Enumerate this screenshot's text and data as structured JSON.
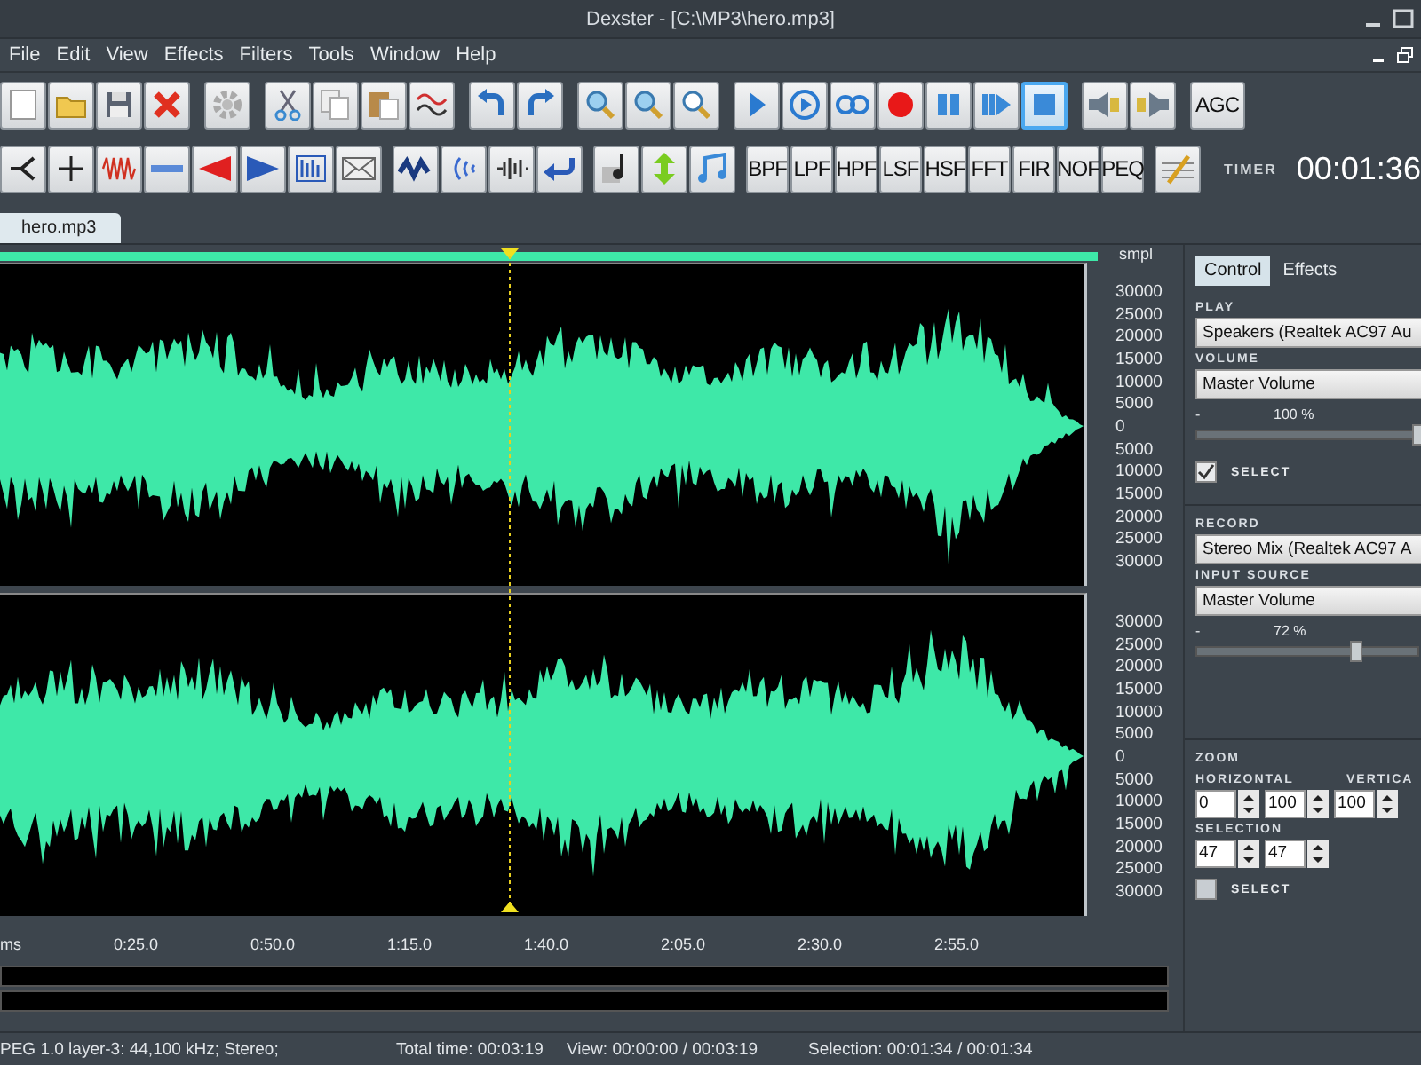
{
  "window": {
    "title": "Dexster - [C:\\MP3\\hero.mp3]"
  },
  "menu": [
    "File",
    "Edit",
    "View",
    "Effects",
    "Filters",
    "Tools",
    "Window",
    "Help"
  ],
  "toolbar_1": {
    "transport": [
      {
        "selected": false
      },
      {
        "selected": false
      },
      {
        "selected": false
      },
      {
        "selected": false
      },
      {
        "selected": false
      },
      {
        "selected": false
      },
      {
        "selected": true
      }
    ],
    "agc": "AGC"
  },
  "toolbar_2": {
    "filters": [
      "BPF",
      "LPF",
      "HPF",
      "LSF",
      "HSF",
      "FFT",
      "FIR",
      "NOF",
      "PEQ"
    ],
    "timer_label": "TIMER",
    "timer": "00:01:36"
  },
  "document_tabs": [
    {
      "label": "hero.mp3",
      "selected": true
    }
  ],
  "waveform": {
    "unit": "smpl",
    "channels": [
      {
        "ticks": [
          "30000",
          "25000",
          "20000",
          "15000",
          "10000",
          "5000",
          "0",
          "5000",
          "10000",
          "15000",
          "20000",
          "25000",
          "30000"
        ]
      },
      {
        "ticks": [
          "30000",
          "25000",
          "20000",
          "15000",
          "10000",
          "5000",
          "0",
          "5000",
          "10000",
          "15000",
          "20000",
          "25000",
          "30000"
        ]
      }
    ],
    "time_labels": [
      "ms",
      "0:25.0",
      "0:50.0",
      "1:15.0",
      "1:40.0",
      "2:05.0",
      "2:30.0",
      "2:55.0"
    ]
  },
  "panel": {
    "tabs": [
      {
        "label": "Control",
        "selected": true
      },
      {
        "label": "Effects",
        "selected": false
      }
    ],
    "play_label": "PLAY",
    "play_device": "Speakers (Realtek AC97 Au",
    "volume_label": "VOLUME",
    "volume_source": "Master Volume",
    "volume_min": "-",
    "volume_reading": "100 %",
    "volume": {
      "level": 1.0
    },
    "play_select": {
      "label": "SELECT",
      "checked": true
    },
    "record_label": "RECORD",
    "record_device": "Stereo Mix (Realtek AC97 A",
    "input_label": "INPUT SOURCE",
    "input_source": "Master Volume",
    "input_min": "-",
    "input_reading": "72 %",
    "input": {
      "level": 0.72
    },
    "zoom_label": "ZOOM",
    "horizontal_label": "HORIZONTAL",
    "horizontal_from": "0",
    "horizontal_to": "100",
    "vertical_label": "VERTICA",
    "vertical_value": "100",
    "selection_label": "SELECTION",
    "selection_from": "47",
    "selection_to": "47",
    "zoom_select": {
      "label": "SELECT",
      "checked": false
    }
  },
  "status_bar": {
    "format": "PEG 1.0 layer-3: 44,100 kHz; Stereo;",
    "total": "Total time: 00:03:19",
    "view": "View: 00:00:00 / 00:03:19",
    "selection": "Selection: 00:01:34 / 00:01:34"
  }
}
